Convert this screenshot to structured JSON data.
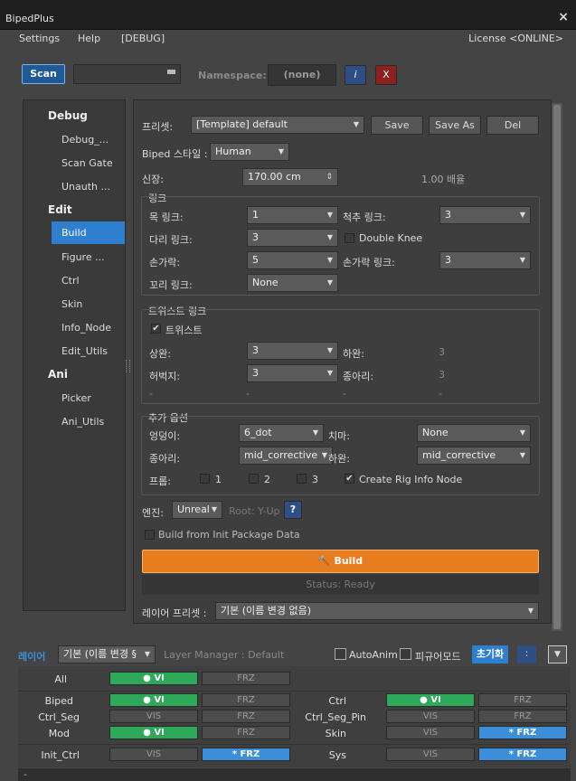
{
  "window": {
    "title": "BipedPlus",
    "close": "×"
  },
  "menu": {
    "settings": "Settings",
    "help": "Help",
    "debug": "[DEBUG]",
    "license": "License <ONLINE>"
  },
  "toolbar": {
    "scan": "Scan",
    "namespace_label": "Namespace:",
    "namespace_value": "(none)",
    "info": "i",
    "clear": "X"
  },
  "sidebar": {
    "debug_header": "Debug",
    "debug_items": [
      "Debug_...",
      "Scan Gate",
      "Unauth ..."
    ],
    "edit_header": "Edit",
    "edit_items": [
      "Build",
      "Figure ...",
      "Ctrl",
      "Skin",
      "Info_Node",
      "Edit_Utils"
    ],
    "ani_header": "Ani",
    "ani_items": [
      "Picker",
      "Ani_Utils"
    ]
  },
  "preset": {
    "label": "프리셋:",
    "value": "[Template] default",
    "save": "Save",
    "save_as": "Save As",
    "del": "Del"
  },
  "biped_style": {
    "label": "Biped 스타일 :",
    "value": "Human"
  },
  "height": {
    "label": "신장:",
    "value": "170.00 cm",
    "scale": "1.00 배율"
  },
  "links": {
    "title": "링크",
    "neck": {
      "label": "목 링크:",
      "value": "1"
    },
    "spine": {
      "label": "척추 링크:",
      "value": "3"
    },
    "leg": {
      "label": "다리 링크:",
      "value": "3"
    },
    "double_knee": "Double Knee",
    "finger": {
      "label": "손가락:",
      "value": "5"
    },
    "finger_link": {
      "label": "손가락 링크:",
      "value": "3"
    },
    "tail": {
      "label": "꼬리 링크:",
      "value": "None"
    }
  },
  "twist": {
    "title": "트위스트 링크",
    "enable": "트위스트",
    "upper_arm": {
      "label": "상완:",
      "value": "3"
    },
    "forearm": {
      "label": "하완:",
      "value": "3"
    },
    "thigh": {
      "label": "허벅지:",
      "value": "3"
    },
    "calf": {
      "label": "종아리:",
      "value": "3"
    },
    "dash": "-"
  },
  "extra": {
    "title": "추가 옵션",
    "hip": {
      "label": "엉덩이:",
      "value": "6_dot"
    },
    "skirt": {
      "label": "치마:",
      "value": "None"
    },
    "calf": {
      "label": "종아리:",
      "value": "mid_corrective"
    },
    "forearm": {
      "label": "하완:",
      "value": "mid_corrective"
    },
    "pelvis": {
      "label": "프롭:",
      "o1": "1",
      "o2": "2",
      "o3": "3"
    },
    "rig_info": "Create Rig Info Node"
  },
  "engine": {
    "label": "엔진:",
    "value": "Unreal",
    "root": "Root: Y-Up",
    "help": "?"
  },
  "init_package": "Build from Init Package Data",
  "build": {
    "label": "Build",
    "status": "Status: Ready"
  },
  "layer_preset": {
    "label": "레이어 프리셋 :",
    "value": "기본 (이름 변경 없음)"
  },
  "layer_bar": {
    "label": "레이어",
    "value": "기본 (이름 변경 §",
    "manager": "Layer Manager : Default",
    "autoanim": "AutoAnim",
    "figure_mode": "피규어모드",
    "reset": "초기화",
    "menu": ":",
    "collapse": "▼"
  },
  "layers": {
    "vi_on": "● VI",
    "vi": "VIS",
    "frz": "FRZ",
    "frz_on": "* FRZ",
    "all": "All",
    "biped": "Biped",
    "ctrl_seg": "Ctrl_Seg",
    "mod": "Mod",
    "init_ctrl": "Init_Ctrl",
    "ctrl": "Ctrl",
    "ctrl_seg_pin": "Ctrl_Seg_Pin",
    "skin": "Skin",
    "sys": "Sys"
  },
  "footer": "-"
}
